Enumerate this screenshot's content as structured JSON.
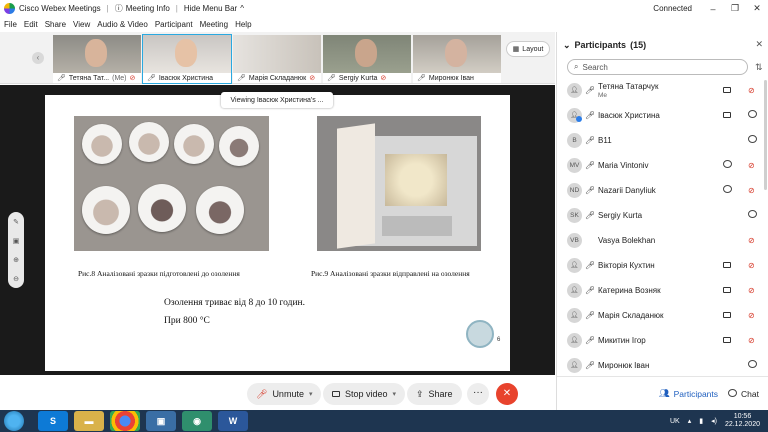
{
  "titlebar": {
    "app_title": "Cisco Webex Meetings",
    "meeting_info": "Meeting Info",
    "hide_menu": "Hide Menu Bar",
    "status": "Connected"
  },
  "menu": [
    "File",
    "Edit",
    "Share",
    "View",
    "Audio & Video",
    "Participant",
    "Meeting",
    "Help"
  ],
  "tiles": [
    {
      "name": "Тетяна Тат...",
      "me": "(Me)"
    },
    {
      "name": "Івасюк Христина",
      "me": ""
    },
    {
      "name": "Марія Складанюк",
      "me": ""
    },
    {
      "name": "Sergiy Kurta",
      "me": ""
    },
    {
      "name": "Миронюк Іван",
      "me": ""
    }
  ],
  "layout_label": "Layout",
  "viewing_label": "Viewing Івасюк Христина's ...",
  "slide": {
    "caption_left": "Рис.8 Аналізовані зразки підготовлені до озолення",
    "caption_right": "Рис.9 Аналізовані зразки відправлені  на озолення",
    "line1": "Озолення триває від 8 до 10 годин.",
    "line2": "При  800  °С",
    "page_number": "6"
  },
  "controls": {
    "unmute": "Unmute",
    "stop_video": "Stop video",
    "share": "Share",
    "more": "···",
    "end": "✕"
  },
  "participants_panel": {
    "title": "Participants",
    "count": "(15)",
    "search_placeholder": "Search",
    "rows": [
      {
        "name": "Тетяна Татарчук",
        "sub": "Me",
        "avatar": ""
      },
      {
        "name": "Івасюк Христина",
        "sub": "",
        "avatar": ""
      },
      {
        "name": "B11",
        "sub": "",
        "avatar": "B"
      },
      {
        "name": "Maria Vintoniv",
        "sub": "",
        "avatar": "MV"
      },
      {
        "name": "Nazarii Danyliuk",
        "sub": "",
        "avatar": "ND"
      },
      {
        "name": "Sergiy Kurta",
        "sub": "",
        "avatar": "SK"
      },
      {
        "name": "Vasya Bolekhan",
        "sub": "",
        "avatar": "VB"
      },
      {
        "name": "Вікторія Кухтин",
        "sub": "",
        "avatar": ""
      },
      {
        "name": "Катерина Возняк",
        "sub": "",
        "avatar": ""
      },
      {
        "name": "Марія Складанюк",
        "sub": "",
        "avatar": ""
      },
      {
        "name": "Микитин Ігор",
        "sub": "",
        "avatar": ""
      },
      {
        "name": "Миронюк Іван",
        "sub": "",
        "avatar": ""
      }
    ],
    "footer_participants": "Participants",
    "footer_chat": "Chat"
  },
  "taskbar": {
    "lang": "UK",
    "time": "10:56",
    "date": "22.12.2020"
  },
  "colors": {
    "accent": "#2aa9e0",
    "end_call": "#e8432d",
    "muted": "#d73a2a",
    "taskbar": "#1e3550"
  }
}
